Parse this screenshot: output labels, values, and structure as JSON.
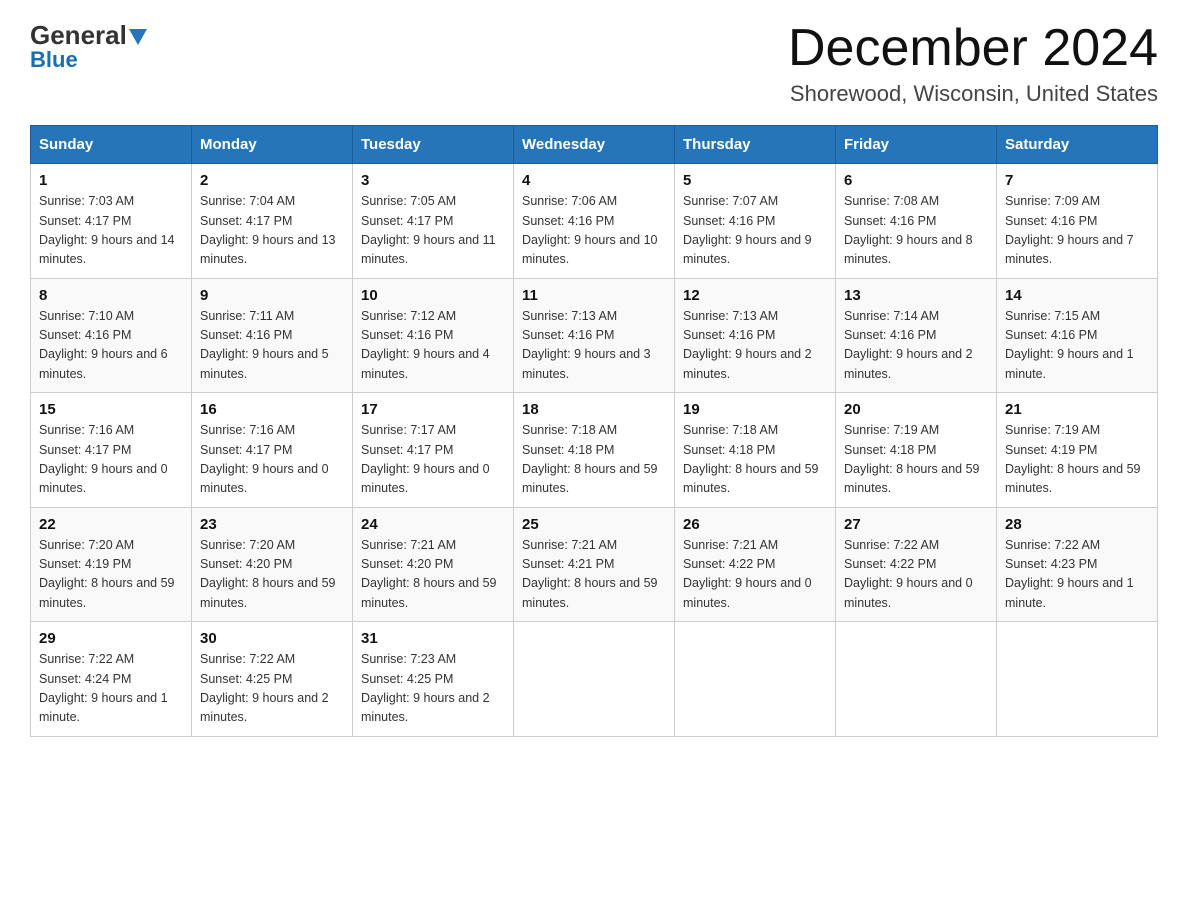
{
  "logo": {
    "general": "General",
    "blue": "Blue"
  },
  "title": "December 2024",
  "subtitle": "Shorewood, Wisconsin, United States",
  "headers": [
    "Sunday",
    "Monday",
    "Tuesday",
    "Wednesday",
    "Thursday",
    "Friday",
    "Saturday"
  ],
  "weeks": [
    [
      {
        "day": "1",
        "sunrise": "7:03 AM",
        "sunset": "4:17 PM",
        "daylight": "9 hours and 14 minutes."
      },
      {
        "day": "2",
        "sunrise": "7:04 AM",
        "sunset": "4:17 PM",
        "daylight": "9 hours and 13 minutes."
      },
      {
        "day": "3",
        "sunrise": "7:05 AM",
        "sunset": "4:17 PM",
        "daylight": "9 hours and 11 minutes."
      },
      {
        "day": "4",
        "sunrise": "7:06 AM",
        "sunset": "4:16 PM",
        "daylight": "9 hours and 10 minutes."
      },
      {
        "day": "5",
        "sunrise": "7:07 AM",
        "sunset": "4:16 PM",
        "daylight": "9 hours and 9 minutes."
      },
      {
        "day": "6",
        "sunrise": "7:08 AM",
        "sunset": "4:16 PM",
        "daylight": "9 hours and 8 minutes."
      },
      {
        "day": "7",
        "sunrise": "7:09 AM",
        "sunset": "4:16 PM",
        "daylight": "9 hours and 7 minutes."
      }
    ],
    [
      {
        "day": "8",
        "sunrise": "7:10 AM",
        "sunset": "4:16 PM",
        "daylight": "9 hours and 6 minutes."
      },
      {
        "day": "9",
        "sunrise": "7:11 AM",
        "sunset": "4:16 PM",
        "daylight": "9 hours and 5 minutes."
      },
      {
        "day": "10",
        "sunrise": "7:12 AM",
        "sunset": "4:16 PM",
        "daylight": "9 hours and 4 minutes."
      },
      {
        "day": "11",
        "sunrise": "7:13 AM",
        "sunset": "4:16 PM",
        "daylight": "9 hours and 3 minutes."
      },
      {
        "day": "12",
        "sunrise": "7:13 AM",
        "sunset": "4:16 PM",
        "daylight": "9 hours and 2 minutes."
      },
      {
        "day": "13",
        "sunrise": "7:14 AM",
        "sunset": "4:16 PM",
        "daylight": "9 hours and 2 minutes."
      },
      {
        "day": "14",
        "sunrise": "7:15 AM",
        "sunset": "4:16 PM",
        "daylight": "9 hours and 1 minute."
      }
    ],
    [
      {
        "day": "15",
        "sunrise": "7:16 AM",
        "sunset": "4:17 PM",
        "daylight": "9 hours and 0 minutes."
      },
      {
        "day": "16",
        "sunrise": "7:16 AM",
        "sunset": "4:17 PM",
        "daylight": "9 hours and 0 minutes."
      },
      {
        "day": "17",
        "sunrise": "7:17 AM",
        "sunset": "4:17 PM",
        "daylight": "9 hours and 0 minutes."
      },
      {
        "day": "18",
        "sunrise": "7:18 AM",
        "sunset": "4:18 PM",
        "daylight": "8 hours and 59 minutes."
      },
      {
        "day": "19",
        "sunrise": "7:18 AM",
        "sunset": "4:18 PM",
        "daylight": "8 hours and 59 minutes."
      },
      {
        "day": "20",
        "sunrise": "7:19 AM",
        "sunset": "4:18 PM",
        "daylight": "8 hours and 59 minutes."
      },
      {
        "day": "21",
        "sunrise": "7:19 AM",
        "sunset": "4:19 PM",
        "daylight": "8 hours and 59 minutes."
      }
    ],
    [
      {
        "day": "22",
        "sunrise": "7:20 AM",
        "sunset": "4:19 PM",
        "daylight": "8 hours and 59 minutes."
      },
      {
        "day": "23",
        "sunrise": "7:20 AM",
        "sunset": "4:20 PM",
        "daylight": "8 hours and 59 minutes."
      },
      {
        "day": "24",
        "sunrise": "7:21 AM",
        "sunset": "4:20 PM",
        "daylight": "8 hours and 59 minutes."
      },
      {
        "day": "25",
        "sunrise": "7:21 AM",
        "sunset": "4:21 PM",
        "daylight": "8 hours and 59 minutes."
      },
      {
        "day": "26",
        "sunrise": "7:21 AM",
        "sunset": "4:22 PM",
        "daylight": "9 hours and 0 minutes."
      },
      {
        "day": "27",
        "sunrise": "7:22 AM",
        "sunset": "4:22 PM",
        "daylight": "9 hours and 0 minutes."
      },
      {
        "day": "28",
        "sunrise": "7:22 AM",
        "sunset": "4:23 PM",
        "daylight": "9 hours and 1 minute."
      }
    ],
    [
      {
        "day": "29",
        "sunrise": "7:22 AM",
        "sunset": "4:24 PM",
        "daylight": "9 hours and 1 minute."
      },
      {
        "day": "30",
        "sunrise": "7:22 AM",
        "sunset": "4:25 PM",
        "daylight": "9 hours and 2 minutes."
      },
      {
        "day": "31",
        "sunrise": "7:23 AM",
        "sunset": "4:25 PM",
        "daylight": "9 hours and 2 minutes."
      },
      null,
      null,
      null,
      null
    ]
  ]
}
